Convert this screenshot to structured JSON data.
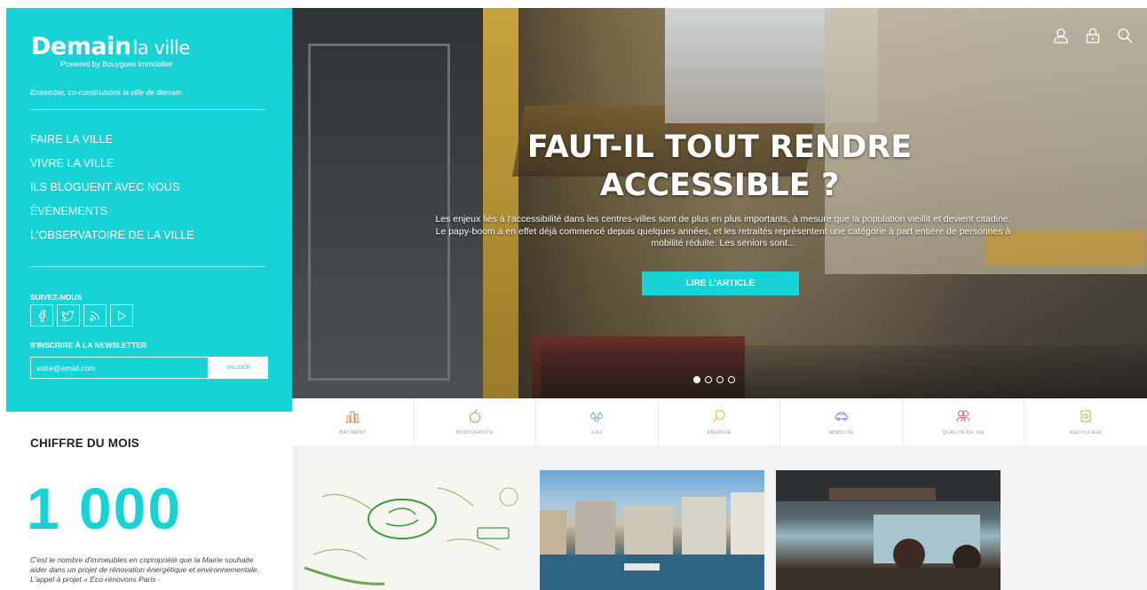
{
  "site": {
    "logo_bold": "Demain",
    "logo_light": "la ville",
    "logo_sub": "Powered by Bouygues Immobilier",
    "tagline": "Ensemble, co-construisons la ville de demain"
  },
  "menu": [
    {
      "label": "FAIRE LA VILLE"
    },
    {
      "label": "VIVRE LA VILLE"
    },
    {
      "label": "ILS BLOGUENT AVEC NOUS"
    },
    {
      "label": "ÉVÉNEMENTS"
    },
    {
      "label": "L'OBSERVATOIRE DE LA VILLE"
    }
  ],
  "follow": {
    "label": "SUIVEZ-NOUS",
    "icons": [
      "facebook-icon",
      "twitter-icon",
      "rss-icon",
      "play-icon"
    ],
    "glyphs": [
      "f",
      "🐦",
      "∶",
      "▷"
    ]
  },
  "newsletter": {
    "label": "S'INSCRIRE À LA NEWSLETTER",
    "placeholder": "votre@email.com",
    "button": "VALIDER"
  },
  "chiffre": {
    "title": "CHIFFRE DU MOIS",
    "number": "1 000",
    "description": "C'est le nombre d'immeubles en copropriété que la Mairie souhaite aider dans un projet de rénovation énergétique et environnementale. L'appel à projet « Éco-rénovons Paris -"
  },
  "hero": {
    "title_line1": "FAUT-IL TOUT RENDRE",
    "title_line2": "ACCESSIBLE ?",
    "text": "Les enjeux liés à l'accessibilité dans les centres-villes sont de plus en plus importants, à mesure que la population vieillit et devient citadine. Le papy-boom a en effet déjà commencé depuis quelques années, et les retraités représentent une catégorie à part entière de personnes à mobilité réduite. Les seniors sont...",
    "button": "LIRE L'ARTICLE",
    "slides": 4,
    "active_slide": 1,
    "header_icons": [
      "user-icon",
      "lock-icon",
      "search-icon"
    ]
  },
  "categories": [
    {
      "label": "BÂTIMENT",
      "icon": "building-icon",
      "color": "#e8855a"
    },
    {
      "label": "BIODIVERSITÉ",
      "icon": "apple-icon",
      "color": "#7bc043"
    },
    {
      "label": "EAU",
      "icon": "water-drops-icon",
      "color": "#5aa9e0"
    },
    {
      "label": "ENERGIE",
      "icon": "energy-icon",
      "color": "#f2b233"
    },
    {
      "label": "MOBILITÉ",
      "icon": "car-icon",
      "color": "#7a8fcf"
    },
    {
      "label": "QUALITÉ DE VIE",
      "icon": "people-icon",
      "color": "#e0567a"
    },
    {
      "label": "RECYCLAGE",
      "icon": "recycle-icon",
      "color": "#8cc63f"
    }
  ],
  "colors": {
    "accent": "#18d3d6"
  }
}
